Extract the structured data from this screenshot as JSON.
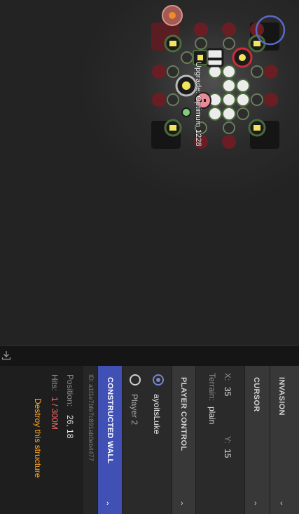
{
  "map": {
    "tooltip": "Upgrade: Optimum 1228"
  },
  "panels": {
    "invasion": {
      "title": "INVASION"
    },
    "cursor": {
      "title": "CURSOR",
      "x_label": "X:",
      "x_value": "35",
      "y_label": "Y:",
      "y_value": "15",
      "terrain_label": "Terrain:",
      "terrain_value": "plain"
    },
    "player_control": {
      "title": "PLAYER CONTROL",
      "players": [
        {
          "name": "ayoitsLuke",
          "selected": true
        },
        {
          "name": "Player 2",
          "selected": false
        }
      ]
    },
    "structure": {
      "title": "CONSTRUCTED WALL",
      "id": "ID: a1f1e7bfe7c891ab0eb4477",
      "position_label": "Position:",
      "position_value": "26, 18",
      "hits_label": "Hits:",
      "hits_value": "1 / 300M",
      "destroy_label": "Destroy this structure"
    }
  },
  "colors": {
    "accent": "#4050b5",
    "hits": "#ff6b6b",
    "destroy": "#ffa726",
    "radio": "#7986cb"
  },
  "icons": [
    "download-icon",
    "chevron-left-icon",
    "chevron-right-icon"
  ]
}
